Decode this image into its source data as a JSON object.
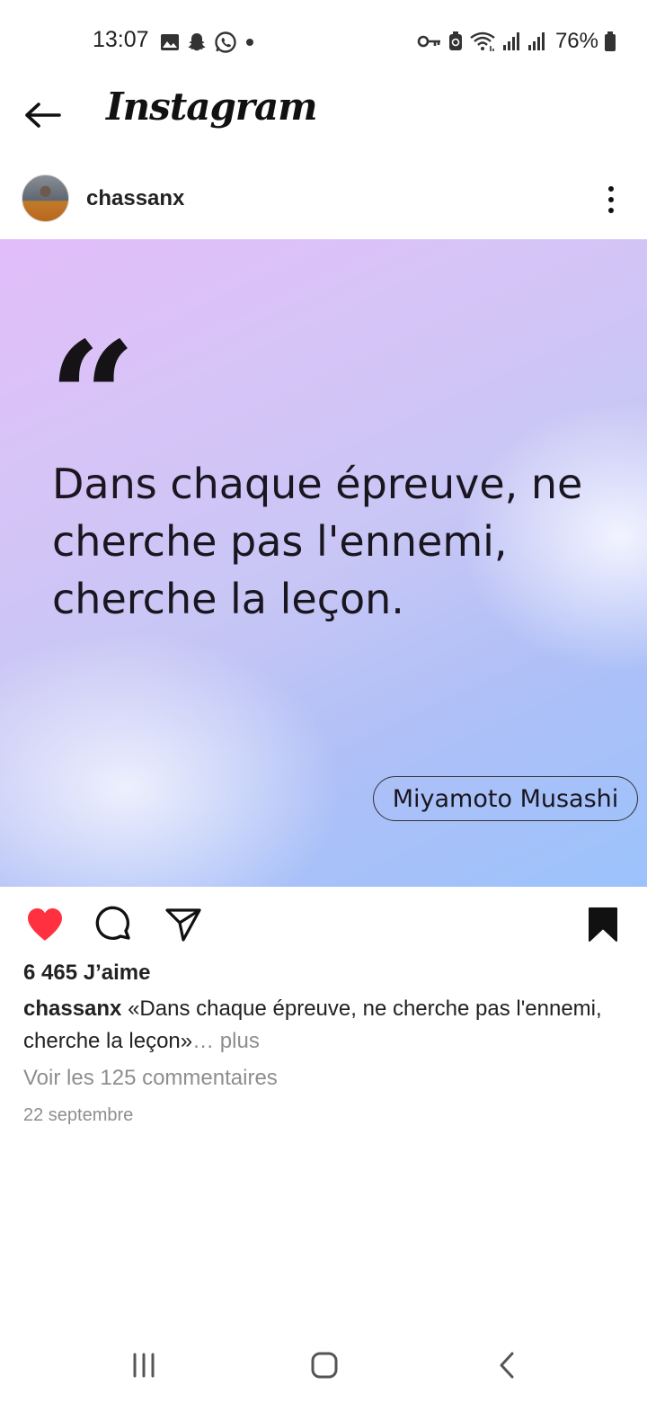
{
  "status_bar": {
    "time": "13:07",
    "battery": "76%",
    "left_icons": [
      "gallery-icon",
      "snapchat-icon",
      "whatsapp-icon",
      "dot-icon"
    ],
    "right_icons": [
      "key-icon",
      "battery-saver-icon",
      "wifi-icon",
      "signal-icon",
      "signal-icon",
      "battery-icon"
    ]
  },
  "header": {
    "app_name": "Instagram",
    "back_icon": "arrow-left-icon"
  },
  "post": {
    "username": "chassanx",
    "more_icon": "more-vertical-icon",
    "image": {
      "quote_mark": "“",
      "quote": "Dans chaque épreuve, ne cherche pas l'ennemi, cherche la leçon.",
      "author": "Miyamoto Musashi"
    },
    "actions": {
      "like_icon": "heart-filled-icon",
      "comment_icon": "comment-icon",
      "share_icon": "send-icon",
      "save_icon": "bookmark-filled-icon",
      "like_color": "#ff3040"
    },
    "likes": "6 465 J’aime",
    "caption_user": "chassanx",
    "caption_text": " «Dans chaque épreuve, ne cherche pas l'ennemi, cherche la leçon»",
    "caption_more": "… plus",
    "comments_link": "Voir les 125 commentaires",
    "date": "22 septembre"
  },
  "nav_bar": {
    "recents_icon": "recents-icon",
    "home_icon": "home-icon",
    "back_icon": "back-chevron-icon"
  }
}
